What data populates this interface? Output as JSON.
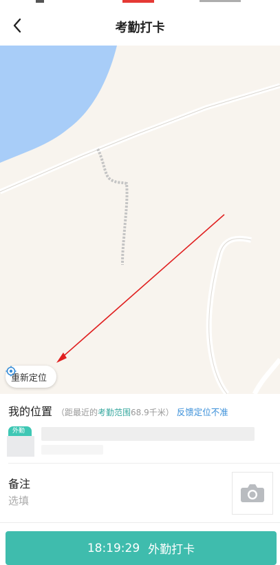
{
  "header": {
    "title": "考勤打卡",
    "back_icon": "chevron-left-icon"
  },
  "map": {
    "water_color": "#a8cdf8",
    "land_color": "#f8f4ee",
    "relocate_label": "重新定位",
    "relocate_icon": "locate-icon"
  },
  "location": {
    "title": "我的位置",
    "hint_open": "（距最近的",
    "hint_range_link": "考勤范围",
    "hint_distance": "68.9千米",
    "hint_close": "）",
    "feedback_label": "反馈定位不准",
    "badge_label": "外勤",
    "accent_color": "#3aa9a0",
    "link_color": "#3a8fd9"
  },
  "remark": {
    "label": "备注",
    "placeholder": "选填",
    "photo_icon": "camera-icon"
  },
  "punch": {
    "time": "18:19:29",
    "label": "外勤打卡",
    "color": "#3fbcad"
  }
}
